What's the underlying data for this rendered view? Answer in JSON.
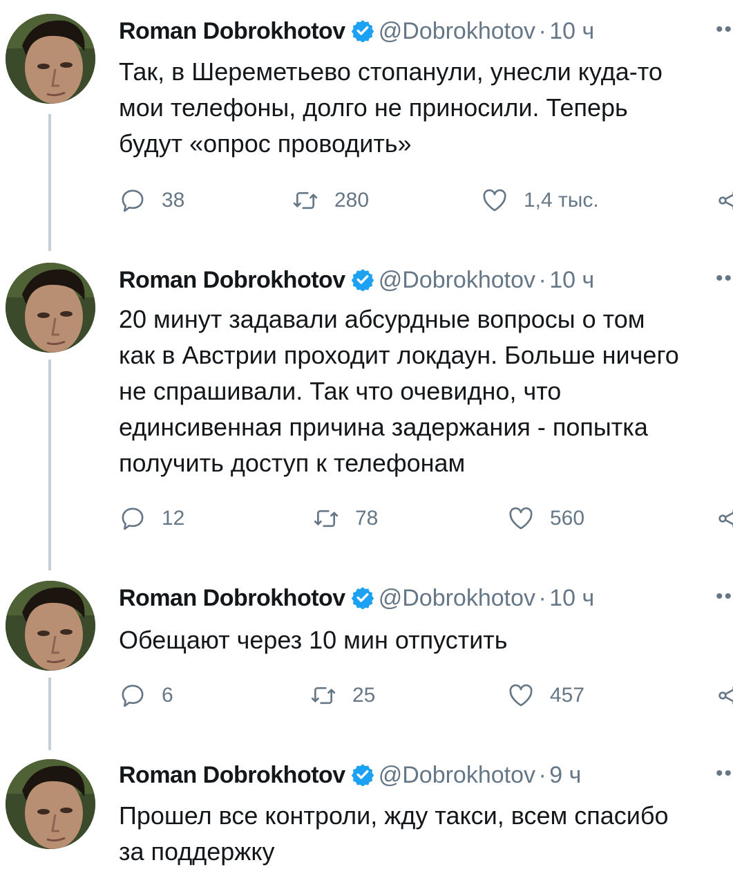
{
  "colors": {
    "secondary": "#657786",
    "verified": "#1da1f2",
    "thread_line": "#c4cfd6"
  },
  "tweets": [
    {
      "name": "Roman Dobrokhotov",
      "handle": "@Dobrokhotov",
      "dot": "·",
      "time": "10 ч",
      "text": "Так, в Шереметьево стопанули, унесли куда-то\nмои телефоны, долго не приносили. Теперь\nбудут «опрос проводить»",
      "replies": "38",
      "retweets": "280",
      "likes": "1,4 тыс."
    },
    {
      "name": "Roman Dobrokhotov",
      "handle": "@Dobrokhotov",
      "dot": "·",
      "time": "10 ч",
      "text": "20 минут задавали абсурдные вопросы о том\nкак в Австрии проходит локдаун. Больше ничего\nне спрашивали. Так что очевидно, что\nединсивенная причина задержания - попытка\nполучить доступ к телефонам",
      "replies": "12",
      "retweets": "78",
      "likes": "560"
    },
    {
      "name": "Roman Dobrokhotov",
      "handle": "@Dobrokhotov",
      "dot": "·",
      "time": "10 ч",
      "text": "Обещают через 10 мин отпустить",
      "replies": "6",
      "retweets": "25",
      "likes": "457"
    },
    {
      "name": "Roman Dobrokhotov",
      "handle": "@Dobrokhotov",
      "dot": "·",
      "time": "9 ч",
      "text": "Прошел все контроли, жду такси, всем спасибо\nза поддержку"
    }
  ],
  "icons": {
    "verified": "verified-badge-icon",
    "more": "more-options-icon",
    "reply": "reply-icon",
    "retweet": "retweet-icon",
    "like": "heart-icon",
    "share": "share-icon"
  }
}
